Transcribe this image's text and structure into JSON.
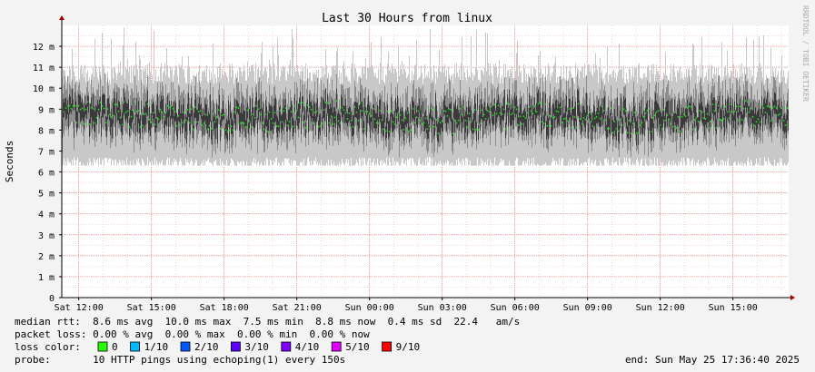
{
  "chart_data": {
    "type": "area",
    "title": "Last 30 Hours from linux",
    "ylabel": "Seconds",
    "xlabel": "",
    "watermark": "RRDTOOL / TOBI OETIKER",
    "ylim": [
      0,
      13
    ],
    "y_unit_label": "m",
    "y_ticks": [
      0,
      1,
      2,
      3,
      4,
      5,
      6,
      7,
      8,
      9,
      10,
      11,
      12
    ],
    "x_range_hours": [
      0,
      30
    ],
    "x_ticks": [
      {
        "at": 0.7,
        "label": "Sat 12:00"
      },
      {
        "at": 3.7,
        "label": "Sat 15:00"
      },
      {
        "at": 6.7,
        "label": "Sat 18:00"
      },
      {
        "at": 9.7,
        "label": "Sat 21:00"
      },
      {
        "at": 12.7,
        "label": "Sun 00:00"
      },
      {
        "at": 15.7,
        "label": "Sun 03:00"
      },
      {
        "at": 18.7,
        "label": "Sun 06:00"
      },
      {
        "at": 21.7,
        "label": "Sun 09:00"
      },
      {
        "at": 24.7,
        "label": "Sun 12:00"
      },
      {
        "at": 27.7,
        "label": "Sun 15:00"
      }
    ],
    "grid": true,
    "series": [
      {
        "name": "median rtt",
        "approx_level_ms": 8.6,
        "typical_band_ms": [
          7.5,
          10.0
        ],
        "color": "#22dd22"
      }
    ]
  },
  "stats": {
    "line1": "median rtt:  8.6 ms avg  10.0 ms max  7.5 ms min  8.8 ms now  0.4 ms sd  22.4   am/s",
    "line2": "packet loss: 0.00 % avg  0.00 % max  0.00 % min  0.00 % now",
    "line3_label": "loss color:",
    "loss_colors": [
      {
        "label": "0",
        "color": "#26ff00"
      },
      {
        "label": "1/10",
        "color": "#00b8ff"
      },
      {
        "label": "2/10",
        "color": "#0059ff"
      },
      {
        "label": "3/10",
        "color": "#5e00ff"
      },
      {
        "label": "4/10",
        "color": "#7e00ff"
      },
      {
        "label": "5/10",
        "color": "#dd00ff"
      },
      {
        "label": "9/10",
        "color": "#ff0000"
      }
    ],
    "probe": "probe:       10 HTTP pings using echoping(1) every 150s",
    "end": "end: Sun May 25 17:36:40 2025"
  }
}
